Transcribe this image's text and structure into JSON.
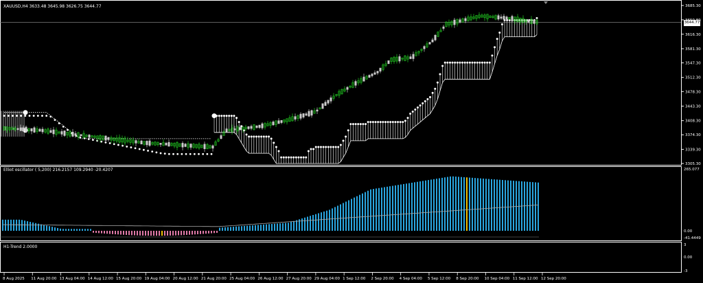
{
  "main_panel": {
    "header": "XAUUSD,H4  3633.48 3645.98 3626.75 3644.77",
    "current_price": "3644.77",
    "y_labels": [
      "3685.30",
      "3650.80",
      "3616.30",
      "3581.30",
      "3547.30",
      "3512.30",
      "3478.30",
      "3443.30",
      "3408.30",
      "3374.30",
      "3339.30",
      "3305.30"
    ]
  },
  "oscillator_panel": {
    "header": "Elliot oscillator ( 5,200) 216.2157 109.2940 -20.4207",
    "y_labels": [
      "265.077",
      "0.00",
      "-41.4449"
    ]
  },
  "trend_panel": {
    "header": "H1-Trend 2.0000",
    "y_labels": [
      "3",
      "0.00",
      "-3"
    ]
  },
  "x_labels": [
    "8 Aug 2025",
    "11 Aug 20:00",
    "13 Aug 04:00",
    "14 Aug 12:00",
    "15 Aug 20:00",
    "19 Aug 04:00",
    "20 Aug 12:00",
    "21 Aug 20:00",
    "25 Aug 04:00",
    "26 Aug 12:00",
    "27 Aug 20:00",
    "29 Aug 04:00",
    "1 Sep 12:00",
    "2 Sep 20:00",
    "4 Sep 04:00",
    "5 Sep 12:00",
    "8 Sep 20:00",
    "10 Sep 04:00",
    "11 Sep 12:00",
    "12 Sep 20:00"
  ],
  "colors": {
    "background": "#000000",
    "candle_up": "#22cc22",
    "candle_down": "#cccccc",
    "trail": "#ffffff",
    "osc_pos": "#2aa6e0",
    "osc_neg": "#e07aa8",
    "osc_highlight": "#f2c200",
    "grid_line": "#808080"
  },
  "chart_data": {
    "type": "candlestick",
    "symbol": "XAUUSD",
    "timeframe": "H4",
    "last_bar": {
      "open": 3633.48,
      "high": 3645.98,
      "low": 3626.75,
      "close": 3644.77
    },
    "ylim": [
      3305.3,
      3685.3
    ],
    "trail_stop": [
      3420,
      3420,
      3420,
      3420,
      3420,
      3420,
      3420,
      3420,
      3420,
      3415,
      3405,
      3395,
      3385,
      3375,
      3370,
      3370,
      3370,
      3370,
      3370,
      3370,
      3370,
      3370,
      3370,
      3365,
      3355,
      3345,
      3335,
      3320,
      3320,
      3320,
      3320,
      3320,
      3320,
      3320,
      3320,
      3320,
      3320,
      3320,
      3335,
      3340,
      3340,
      3345,
      3345,
      3345,
      3345,
      3345,
      3345,
      3345,
      3345,
      3345,
      3345,
      3350,
      3360,
      3370,
      3385,
      3400,
      3400,
      3400,
      3400,
      3400,
      3400,
      3400,
      3405,
      3405,
      3405,
      3405,
      3405,
      3405,
      3405,
      3405,
      3405,
      3405,
      3405,
      3405,
      3405,
      3405,
      3405,
      3408,
      3415,
      3425,
      3430,
      3435,
      3440,
      3445,
      3450,
      3455,
      3460,
      3465,
      3475,
      3485,
      3500,
      3520,
      3540,
      3548,
      3548,
      3548,
      3548,
      3548,
      3548,
      3548,
      3548,
      3548,
      3548,
      3548,
      3548,
      3548,
      3548,
      3548,
      3548,
      3548,
      3548,
      3548,
      3565,
      3585,
      3605,
      3620,
      3640,
      3650,
      3650,
      3650,
      3650,
      3650,
      3650,
      3650,
      3650,
      3650,
      3650,
      3650,
      3650,
      3650,
      3655
    ],
    "oscillator": {
      "values": [
        216.2157,
        109.294,
        -20.4207
      ]
    },
    "h1_trend": 2.0
  }
}
